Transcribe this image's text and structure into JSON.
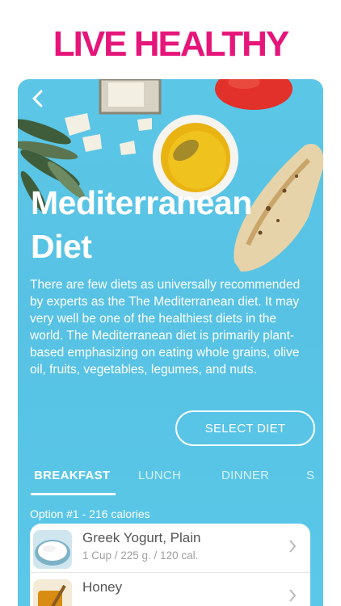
{
  "headline": "LIVE HEALTHY",
  "diet": {
    "title": "Mediterranean Diet",
    "description": "There are few diets as universally recommended by experts as the The Mediterranean diet. It may very well be one of the healthiest diets in the world. The Mediterranean diet is primarily plant-based emphasizing on eating whole grains, olive oil, fruits, vegetables, legumes, and nuts.",
    "select_label": "SELECT DIET"
  },
  "nav": {
    "back_icon": "chevron-left-icon"
  },
  "tabs": [
    {
      "label": "BREAKFAST",
      "active": true
    },
    {
      "label": "LUNCH",
      "active": false
    },
    {
      "label": "DINNER",
      "active": false
    },
    {
      "label": "S",
      "active": false
    }
  ],
  "option_label": "Option #1 - 216 calories",
  "foods": [
    {
      "name": "Greek Yogurt, Plain",
      "detail": "1 Cup / 225 g. / 120 cal.",
      "icon": "yogurt-icon"
    },
    {
      "name": "Honey",
      "detail": "",
      "icon": "honey-icon"
    }
  ],
  "colors": {
    "headline": "#e5157a",
    "card_background": "#5bc5e6",
    "text_on_card": "#ffffff"
  }
}
